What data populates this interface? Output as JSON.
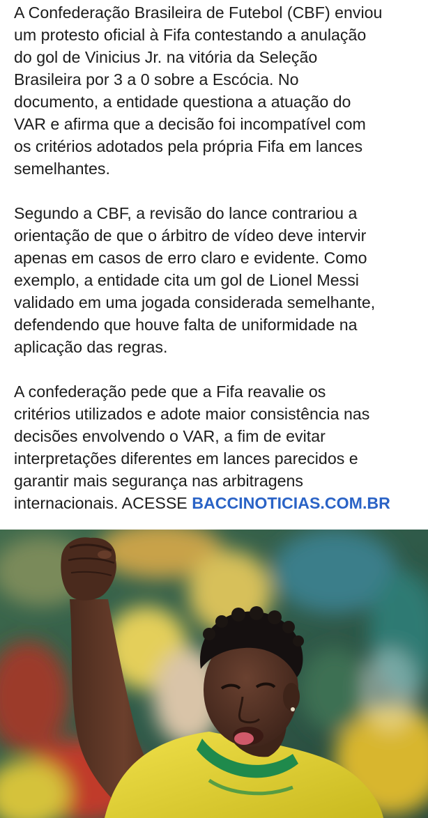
{
  "post": {
    "paragraphs": [
      {
        "lines": [
          "A Confederação Brasileira de Futebol (CBF) enviou",
          "um protesto oficial à Fifa contestando a anulação",
          "do gol de Vinicius Jr. na vitória da Seleção",
          "Brasileira por 3 a 0 sobre a Escócia. No",
          "documento, a entidade questiona a atuação do",
          "VAR e afirma que a decisão foi incompatível com",
          "os critérios adotados pela própria Fifa em lances",
          "semelhantes."
        ]
      },
      {
        "lines": [
          "Segundo a CBF, a revisão do lance contrariou a",
          "orientação de que o árbitro de vídeo deve intervir",
          "apenas em casos de erro claro e evidente. Como",
          "exemplo, a entidade cita um gol de Lionel Messi",
          "validado em uma jogada considerada semelhante,",
          "defendendo que houve falta de uniformidade na",
          "aplicação das regras."
        ]
      },
      {
        "lines": [
          "A confederação pede que a Fifa reavalie os",
          "critérios utilizados e adote maior consistência nas",
          "decisões envolvendo o VAR, a fim de evitar",
          "interpretações diferentes em lances parecidos e",
          "garantir mais segurança nas arbitragens"
        ],
        "last_line_text": "internacionais. ACESSE ",
        "link_text": "BACCINOTICIAS.COM.BR"
      }
    ],
    "link_color": "#2a63c6",
    "text_color": "#1c1c1c"
  },
  "photo": {
    "subject": "player-celebrating-fist-raised",
    "jersey_color": "#e3d431",
    "collar_color": "#1f8a4c"
  }
}
